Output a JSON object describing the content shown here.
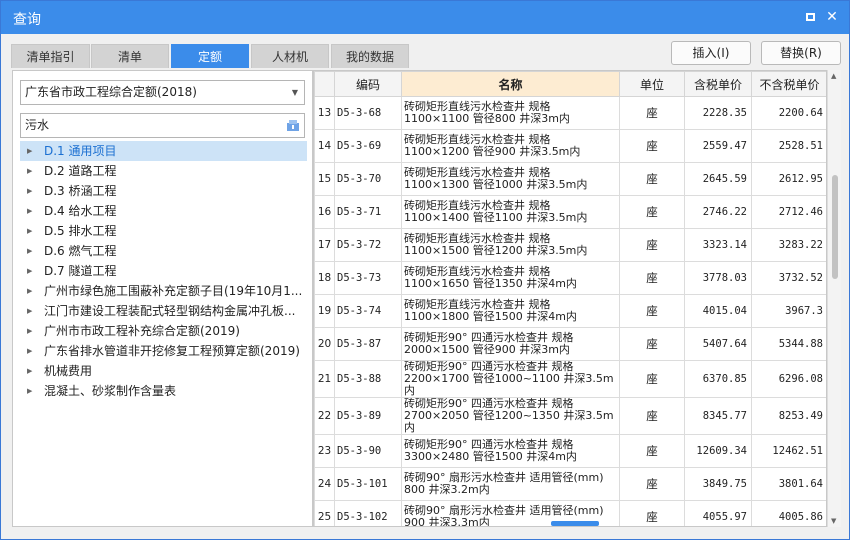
{
  "window": {
    "title": "查询"
  },
  "tabs": [
    {
      "label": "清单指引"
    },
    {
      "label": "清单"
    },
    {
      "label": "定额"
    },
    {
      "label": "人材机"
    },
    {
      "label": "我的数据"
    }
  ],
  "actions": {
    "insert": "插入(I)",
    "replace": "替换(R)"
  },
  "left": {
    "library": "广东省市政工程综合定额(2018)",
    "search_value": "污水",
    "tree": [
      "D.1 通用项目",
      "D.2 道路工程",
      "D.3 桥涵工程",
      "D.4 给水工程",
      "D.5 排水工程",
      "D.6 燃气工程",
      "D.7 隧道工程",
      "广州市绿色施工围蔽补充定额子目(19年10月1...",
      "江门市建设工程装配式轻型钢结构金属冲孔板...",
      "广州市市政工程补充综合定额(2019)",
      "广东省排水管道非开挖修复工程预算定额(2019)",
      "机械费用",
      "混凝土、砂浆制作含量表"
    ]
  },
  "grid": {
    "headers": {
      "num": "",
      "code": "编码",
      "name": "名称",
      "unit": "单位",
      "tax": "含税单价",
      "notax": "不含税单价"
    },
    "rows": [
      {
        "num": "13",
        "code": "D5-3-68",
        "name1": "砖砌矩形直线污水检查井 规格",
        "name2": "1100×1100 管径800 井深3m内",
        "unit": "座",
        "tax": "2228.35",
        "notax": "2200.64"
      },
      {
        "num": "14",
        "code": "D5-3-69",
        "name1": "砖砌矩形直线污水检查井 规格",
        "name2": "1100×1200 管径900 井深3.5m内",
        "unit": "座",
        "tax": "2559.47",
        "notax": "2528.51"
      },
      {
        "num": "15",
        "code": "D5-3-70",
        "name1": "砖砌矩形直线污水检查井 规格",
        "name2": "1100×1300 管径1000 井深3.5m内",
        "unit": "座",
        "tax": "2645.59",
        "notax": "2612.95"
      },
      {
        "num": "16",
        "code": "D5-3-71",
        "name1": "砖砌矩形直线污水检查井 规格",
        "name2": "1100×1400 管径1100 井深3.5m内",
        "unit": "座",
        "tax": "2746.22",
        "notax": "2712.46"
      },
      {
        "num": "17",
        "code": "D5-3-72",
        "name1": "砖砌矩形直线污水检查井 规格",
        "name2": "1100×1500 管径1200 井深3.5m内",
        "unit": "座",
        "tax": "3323.14",
        "notax": "3283.22"
      },
      {
        "num": "18",
        "code": "D5-3-73",
        "name1": "砖砌矩形直线污水检查井 规格",
        "name2": "1100×1650 管径1350 井深4m内",
        "unit": "座",
        "tax": "3778.03",
        "notax": "3732.52"
      },
      {
        "num": "19",
        "code": "D5-3-74",
        "name1": "砖砌矩形直线污水检查井 规格",
        "name2": "1100×1800 管径1500 井深4m内",
        "unit": "座",
        "tax": "4015.04",
        "notax": "3967.3"
      },
      {
        "num": "20",
        "code": "D5-3-87",
        "name1": "砖砌矩形90° 四通污水检查井 规格",
        "name2": "2000×1500 管径900 井深3m内",
        "unit": "座",
        "tax": "5407.64",
        "notax": "5344.88"
      },
      {
        "num": "21",
        "code": "D5-3-88",
        "name1": "砖砌矩形90° 四通污水检查井 规格",
        "name2": "2200×1700 管径1000~1100 井深3.5m内",
        "unit": "座",
        "tax": "6370.85",
        "notax": "6296.08"
      },
      {
        "num": "22",
        "code": "D5-3-89",
        "name1": "砖砌矩形90° 四通污水检查井 规格",
        "name2": "2700×2050 管径1200~1350 井深3.5m内",
        "unit": "座",
        "tax": "8345.77",
        "notax": "8253.49"
      },
      {
        "num": "23",
        "code": "D5-3-90",
        "name1": "砖砌矩形90° 四通污水检查井 规格",
        "name2": "3300×2480 管径1500 井深4m内",
        "unit": "座",
        "tax": "12609.34",
        "notax": "12462.51"
      },
      {
        "num": "24",
        "code": "D5-3-101",
        "name1": "砖砌90° 扇形污水检查井 适用管径(mm)",
        "name2": "800 井深3.2m内",
        "unit": "座",
        "tax": "3849.75",
        "notax": "3801.64"
      },
      {
        "num": "25",
        "code": "D5-3-102",
        "name1": "砖砌90° 扇形污水检查井 适用管径(mm)",
        "name2": "900 井深3.3m内",
        "unit": "座",
        "tax": "4055.97",
        "notax": "4005.86"
      }
    ]
  }
}
